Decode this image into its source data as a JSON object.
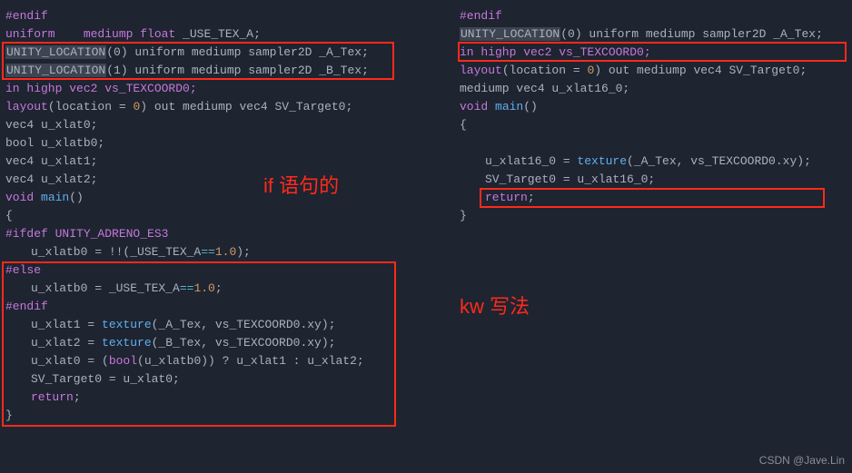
{
  "left": {
    "l01": "#endif",
    "l02_a": "uniform    mediump ",
    "l02_b": "float",
    "l02_c": " _USE_TEX_A;",
    "l03_sel": "UNITY_LOCATION",
    "l03_rest": "(0) uniform mediump sampler2D _A_Tex;",
    "l04_sel": "UNITY_LOCATION",
    "l04_rest": "(1) uniform mediump sampler2D _B_Tex;",
    "l05": "in highp vec2 vs_TEXCOORD0;",
    "l06_a": "layout",
    "l06_b": "(location = ",
    "l06_n": "0",
    "l06_c": ") out mediump vec4 SV_Target0;",
    "l07": "vec4 u_xlat0;",
    "l08": "bool u_xlatb0;",
    "l09": "vec4 u_xlat1;",
    "l10": "vec4 u_xlat2;",
    "l11_a": "void",
    "l11_b": " main",
    "l11_c": "()",
    "l12": "{",
    "l13": "#ifdef UNITY_ADRENO_ES3",
    "l14_a": "u_xlatb0 = !!(_USE_TEX_A",
    "l14_op": "==",
    "l14_n": "1.0",
    "l14_c": ");",
    "l15": "#else",
    "l16_a": "u_xlatb0 = _USE_TEX_A",
    "l16_op": "==",
    "l16_n": "1.0",
    "l16_c": ";",
    "l17": "#endif",
    "l18_a": "u_xlat1 = ",
    "l18_fn": "texture",
    "l18_b": "(_A_Tex, vs_TEXCOORD0.xy);",
    "l19_a": "u_xlat2 = ",
    "l19_fn": "texture",
    "l19_b": "(_B_Tex, vs_TEXCOORD0.xy);",
    "l20_a": "u_xlat0 = (",
    "l20_fn": "bool",
    "l20_b": "(u_xlatb0)) ? u_xlat1 : u_xlat2;",
    "l21": "SV_Target0 = u_xlat0;",
    "l22": "return",
    "l22_b": ";",
    "l23": "}"
  },
  "right": {
    "r01": "#endif",
    "r02_sel": "UNITY_LOCATION",
    "r02_rest": "(0) uniform mediump sampler2D _A_Tex;",
    "r03": "in highp vec2 vs_TEXCOORD0;",
    "r04_a": "layout",
    "r04_b": "(location = ",
    "r04_n": "0",
    "r04_c": ") out mediump vec4 SV_Target0;",
    "r05": "mediump vec4 u_xlat16_0;",
    "r06_a": "void",
    "r06_b": " main",
    "r06_c": "()",
    "r07": "{",
    "r08_a": "u_xlat16_0 = ",
    "r08_fn": "texture",
    "r08_b": "(_A_Tex, vs_TEXCOORD0.xy);",
    "r09": "SV_Target0 = u_xlat16_0;",
    "r10": "return",
    "r10_b": ";",
    "r11": "}"
  },
  "annot": {
    "left": "if 语句的",
    "right": "kw 写法"
  },
  "watermark": "CSDN @Jave.Lin"
}
